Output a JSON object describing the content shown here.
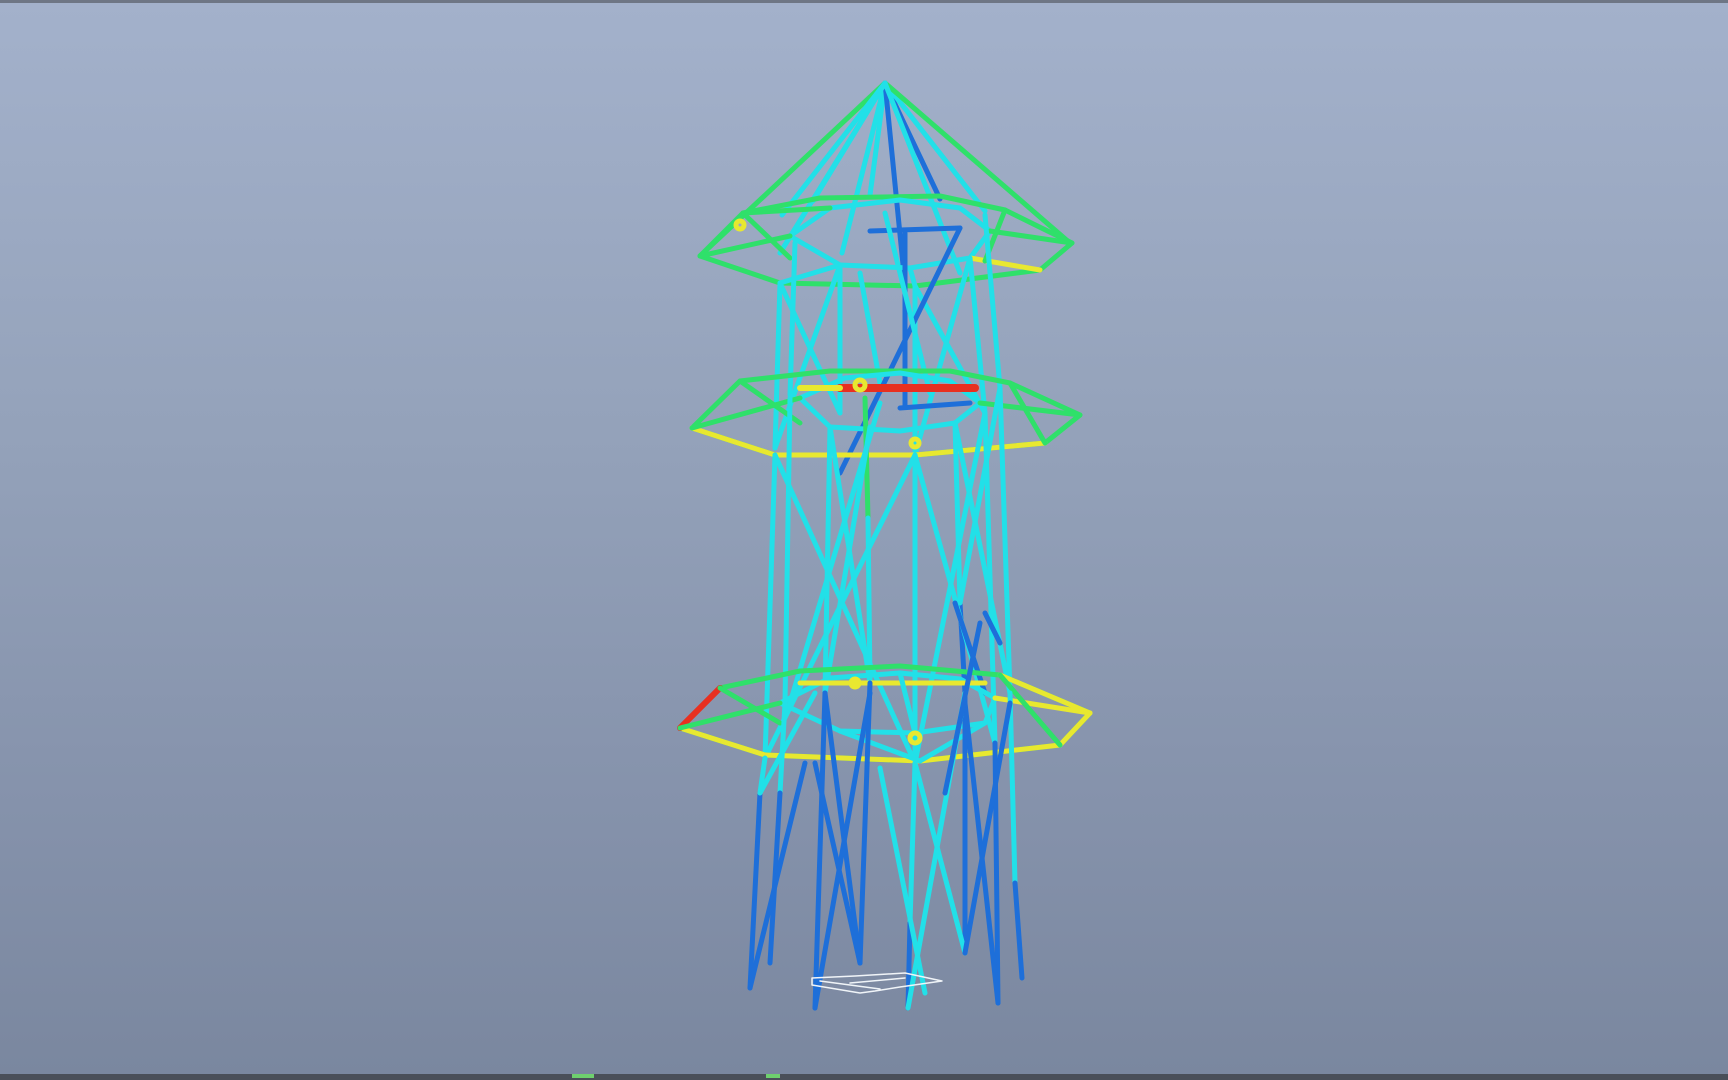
{
  "window": {
    "border_color": "#6e7685"
  },
  "viewport": {
    "background_top": "#a3b1cb",
    "background_bottom": "#7a879f",
    "model": "tower-truss-wireframe",
    "result_colormap": [
      "#1e6fd9",
      "#22e0e8",
      "#2fe06a",
      "#e8e830",
      "#e83020"
    ]
  },
  "status_bar": {
    "indicator_color": "#6ed06e"
  }
}
